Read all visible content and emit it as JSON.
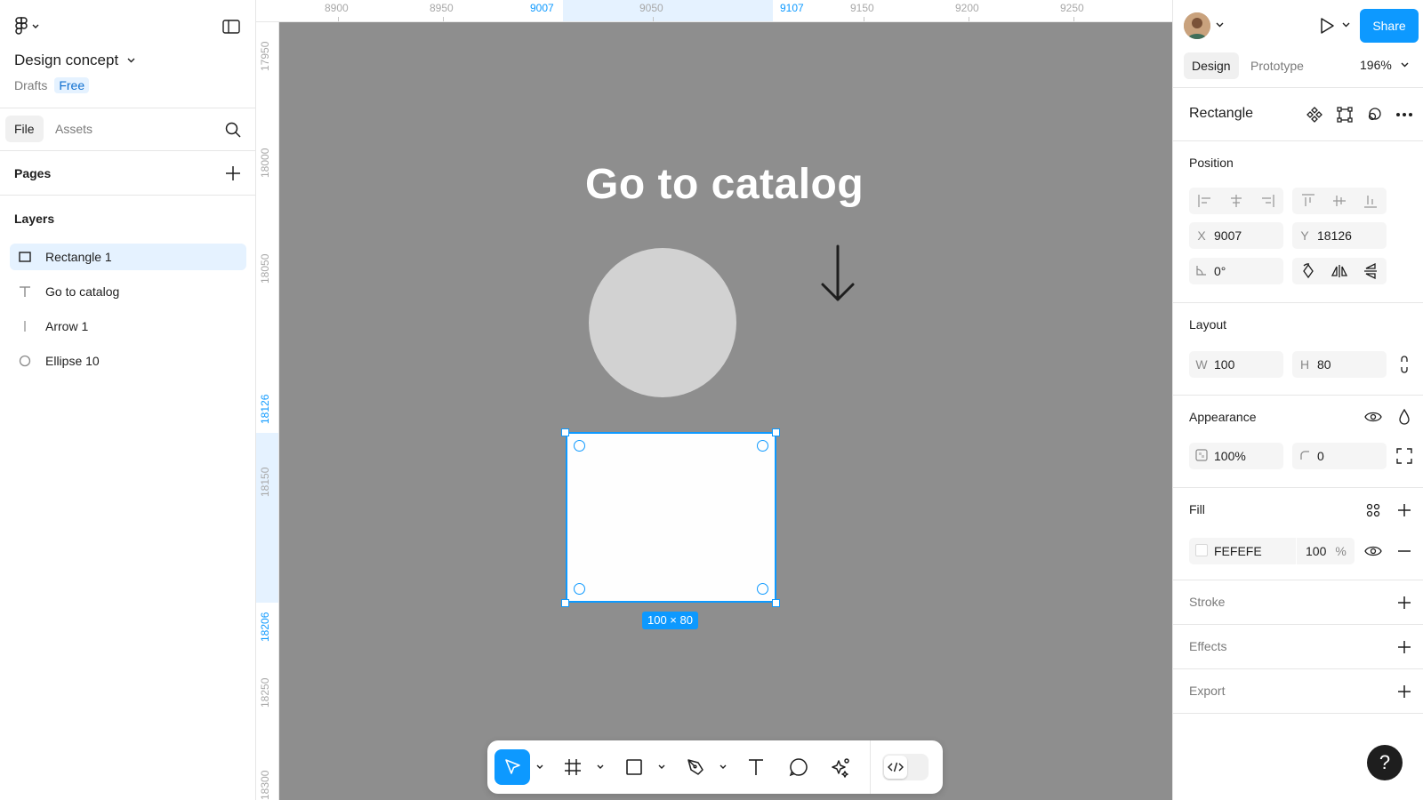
{
  "file": {
    "title": "Design concept",
    "location": "Drafts",
    "plan_badge": "Free"
  },
  "left_tabs": {
    "file": "File",
    "assets": "Assets"
  },
  "pages": {
    "title": "Pages"
  },
  "layers": {
    "title": "Layers",
    "items": [
      {
        "name": "Rectangle 1",
        "icon": "rectangle-icon",
        "selected": true
      },
      {
        "name": "Go to catalog",
        "icon": "text-icon",
        "selected": false
      },
      {
        "name": "Arrow 1",
        "icon": "line-icon",
        "selected": false
      },
      {
        "name": "Ellipse 10",
        "icon": "ellipse-icon",
        "selected": false
      }
    ]
  },
  "ruler": {
    "top": [
      "8900",
      "8950",
      "9007",
      "9050",
      "9107",
      "9150",
      "9200",
      "9250"
    ],
    "left": [
      "17950",
      "18000",
      "18050",
      "18126",
      "18150",
      "18206",
      "18250",
      "18300"
    ]
  },
  "canvas": {
    "heading": "Go to catalog",
    "selection_size": "100 × 80",
    "background": "#8e8e8e"
  },
  "toolbar": {
    "tools": [
      "move-tool",
      "frame-tool",
      "rectangle-tool",
      "pen-tool",
      "text-tool",
      "comment-tool",
      "actions-tool"
    ],
    "accent": "#0d99ff"
  },
  "header": {
    "share_label": "Share",
    "tab_design": "Design",
    "tab_prototype": "Prototype",
    "zoom": "196%"
  },
  "inspector": {
    "object_name": "Rectangle",
    "position": {
      "title": "Position",
      "x_label": "X",
      "x": "9007",
      "y_label": "Y",
      "y": "18126",
      "rotation": "0°"
    },
    "layout": {
      "title": "Layout",
      "w_label": "W",
      "w": "100",
      "h_label": "H",
      "h": "80"
    },
    "appearance": {
      "title": "Appearance",
      "opacity": "100%",
      "radius": "0"
    },
    "fill": {
      "title": "Fill",
      "hex": "FEFEFE",
      "opacity": "100",
      "unit": "%"
    },
    "stroke": {
      "title": "Stroke"
    },
    "effects": {
      "title": "Effects"
    },
    "export": {
      "title": "Export"
    }
  },
  "help_label": "?"
}
